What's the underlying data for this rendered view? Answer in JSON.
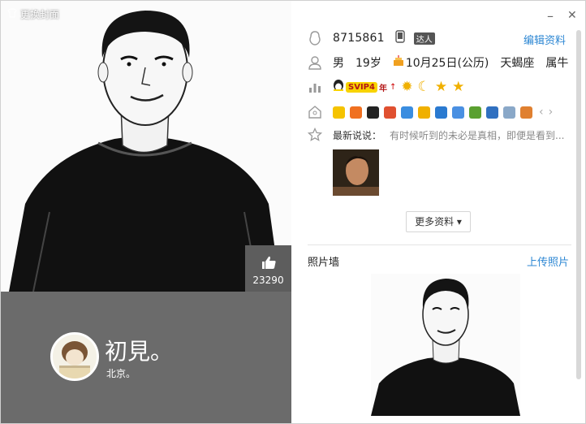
{
  "window": {
    "home_button": "更换封面",
    "minimize": "–",
    "close": "✕"
  },
  "cover": {
    "likes": "23290"
  },
  "user": {
    "nickname": "初見。",
    "location": "北京。"
  },
  "profile": {
    "qq": "8715861",
    "badge": "达人",
    "edit_label": "编辑资料",
    "gender": "男",
    "age": "19岁",
    "birthday": "10月25日(公历)",
    "zodiac": "天蝎座",
    "chinese_zodiac": "属牛",
    "svip": "SVIP4",
    "svip_year": "年",
    "level_icons": [
      "sun",
      "moon",
      "star",
      "star"
    ],
    "status_label": "最新说说：",
    "status_text": "有时候听到的未必是真相，即便是看到..."
  },
  "apps": [
    "diamond",
    "pet",
    "qq-penguin",
    "game",
    "music",
    "star",
    "photo",
    "mail-box",
    "plant",
    "doll",
    "mail",
    "cart"
  ],
  "more_label": "更多资料 ▾",
  "photo_wall": {
    "title": "照片墙",
    "upload": "上传照片"
  },
  "colors": {
    "accent": "#2d87d3",
    "grey_panel": "#6b6b6b",
    "svip_gold": "#f8d300"
  }
}
